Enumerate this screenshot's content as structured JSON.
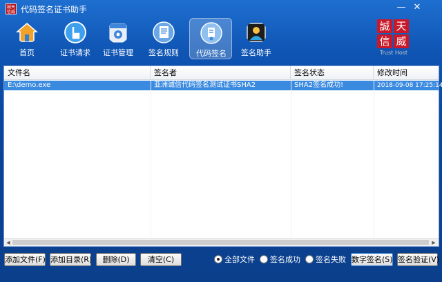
{
  "window": {
    "title": "代码签名证书助手",
    "app_icon_text": "誠天 信威",
    "minimize_glyph": "—",
    "close_glyph": "✕"
  },
  "toolbar": {
    "items": [
      {
        "label": "首页",
        "icon": "home-icon",
        "active": false
      },
      {
        "label": "证书请求",
        "icon": "hand-click-icon",
        "active": false
      },
      {
        "label": "证书管理",
        "icon": "gear-box-icon",
        "active": false
      },
      {
        "label": "签名规则",
        "icon": "document-rules-icon",
        "active": false
      },
      {
        "label": "代码签名",
        "icon": "code-sign-document-icon",
        "active": true
      },
      {
        "label": "签名助手",
        "icon": "assistant-photo-icon",
        "active": false
      }
    ]
  },
  "brand": {
    "chars": [
      "誠",
      "天",
      "信",
      "威"
    ],
    "text": "Trust Host"
  },
  "list": {
    "columns": [
      "文件名",
      "签名者",
      "签名状态",
      "修改时间"
    ],
    "rows": [
      {
        "file": "E:\\demo.exe",
        "signer": "亚洲诚信代码签名测试证书SHA2",
        "status": "SHA2签名成功!",
        "modified": "2018-09-08 17:25:14"
      }
    ]
  },
  "buttons": {
    "add_file": "添加文件(F)",
    "add_dir": "添加目录(R)",
    "delete": "删除(D)",
    "clear": "清空(C)",
    "sign": "数字签名(S)",
    "verify": "签名验证(V)"
  },
  "filter": {
    "options": [
      "全部文件",
      "签名成功",
      "签名失败"
    ],
    "selected": "全部文件"
  },
  "colors": {
    "accent": "#0b4fa8",
    "selection": "#3a8ae0",
    "brand_red": "#c8182a"
  }
}
